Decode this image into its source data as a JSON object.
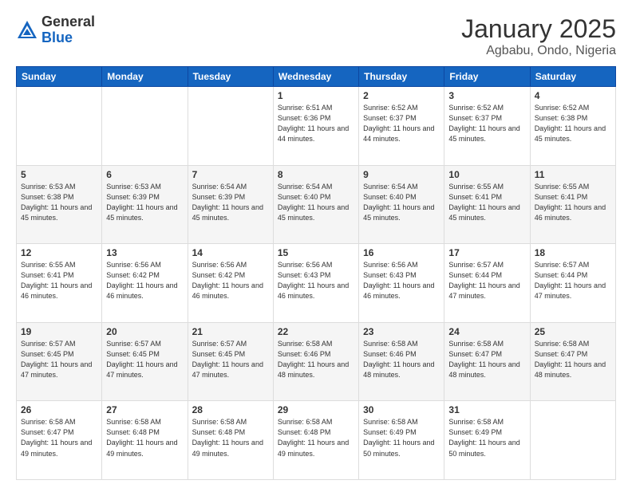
{
  "header": {
    "logo_general": "General",
    "logo_blue": "Blue",
    "month": "January 2025",
    "location": "Agbabu, Ondo, Nigeria"
  },
  "weekdays": [
    "Sunday",
    "Monday",
    "Tuesday",
    "Wednesday",
    "Thursday",
    "Friday",
    "Saturday"
  ],
  "weeks": [
    [
      {
        "day": "",
        "info": ""
      },
      {
        "day": "",
        "info": ""
      },
      {
        "day": "",
        "info": ""
      },
      {
        "day": "1",
        "info": "Sunrise: 6:51 AM\nSunset: 6:36 PM\nDaylight: 11 hours and 44 minutes."
      },
      {
        "day": "2",
        "info": "Sunrise: 6:52 AM\nSunset: 6:37 PM\nDaylight: 11 hours and 44 minutes."
      },
      {
        "day": "3",
        "info": "Sunrise: 6:52 AM\nSunset: 6:37 PM\nDaylight: 11 hours and 45 minutes."
      },
      {
        "day": "4",
        "info": "Sunrise: 6:52 AM\nSunset: 6:38 PM\nDaylight: 11 hours and 45 minutes."
      }
    ],
    [
      {
        "day": "5",
        "info": "Sunrise: 6:53 AM\nSunset: 6:38 PM\nDaylight: 11 hours and 45 minutes."
      },
      {
        "day": "6",
        "info": "Sunrise: 6:53 AM\nSunset: 6:39 PM\nDaylight: 11 hours and 45 minutes."
      },
      {
        "day": "7",
        "info": "Sunrise: 6:54 AM\nSunset: 6:39 PM\nDaylight: 11 hours and 45 minutes."
      },
      {
        "day": "8",
        "info": "Sunrise: 6:54 AM\nSunset: 6:40 PM\nDaylight: 11 hours and 45 minutes."
      },
      {
        "day": "9",
        "info": "Sunrise: 6:54 AM\nSunset: 6:40 PM\nDaylight: 11 hours and 45 minutes."
      },
      {
        "day": "10",
        "info": "Sunrise: 6:55 AM\nSunset: 6:41 PM\nDaylight: 11 hours and 45 minutes."
      },
      {
        "day": "11",
        "info": "Sunrise: 6:55 AM\nSunset: 6:41 PM\nDaylight: 11 hours and 46 minutes."
      }
    ],
    [
      {
        "day": "12",
        "info": "Sunrise: 6:55 AM\nSunset: 6:41 PM\nDaylight: 11 hours and 46 minutes."
      },
      {
        "day": "13",
        "info": "Sunrise: 6:56 AM\nSunset: 6:42 PM\nDaylight: 11 hours and 46 minutes."
      },
      {
        "day": "14",
        "info": "Sunrise: 6:56 AM\nSunset: 6:42 PM\nDaylight: 11 hours and 46 minutes."
      },
      {
        "day": "15",
        "info": "Sunrise: 6:56 AM\nSunset: 6:43 PM\nDaylight: 11 hours and 46 minutes."
      },
      {
        "day": "16",
        "info": "Sunrise: 6:56 AM\nSunset: 6:43 PM\nDaylight: 11 hours and 46 minutes."
      },
      {
        "day": "17",
        "info": "Sunrise: 6:57 AM\nSunset: 6:44 PM\nDaylight: 11 hours and 47 minutes."
      },
      {
        "day": "18",
        "info": "Sunrise: 6:57 AM\nSunset: 6:44 PM\nDaylight: 11 hours and 47 minutes."
      }
    ],
    [
      {
        "day": "19",
        "info": "Sunrise: 6:57 AM\nSunset: 6:45 PM\nDaylight: 11 hours and 47 minutes."
      },
      {
        "day": "20",
        "info": "Sunrise: 6:57 AM\nSunset: 6:45 PM\nDaylight: 11 hours and 47 minutes."
      },
      {
        "day": "21",
        "info": "Sunrise: 6:57 AM\nSunset: 6:45 PM\nDaylight: 11 hours and 47 minutes."
      },
      {
        "day": "22",
        "info": "Sunrise: 6:58 AM\nSunset: 6:46 PM\nDaylight: 11 hours and 48 minutes."
      },
      {
        "day": "23",
        "info": "Sunrise: 6:58 AM\nSunset: 6:46 PM\nDaylight: 11 hours and 48 minutes."
      },
      {
        "day": "24",
        "info": "Sunrise: 6:58 AM\nSunset: 6:47 PM\nDaylight: 11 hours and 48 minutes."
      },
      {
        "day": "25",
        "info": "Sunrise: 6:58 AM\nSunset: 6:47 PM\nDaylight: 11 hours and 48 minutes."
      }
    ],
    [
      {
        "day": "26",
        "info": "Sunrise: 6:58 AM\nSunset: 6:47 PM\nDaylight: 11 hours and 49 minutes."
      },
      {
        "day": "27",
        "info": "Sunrise: 6:58 AM\nSunset: 6:48 PM\nDaylight: 11 hours and 49 minutes."
      },
      {
        "day": "28",
        "info": "Sunrise: 6:58 AM\nSunset: 6:48 PM\nDaylight: 11 hours and 49 minutes."
      },
      {
        "day": "29",
        "info": "Sunrise: 6:58 AM\nSunset: 6:48 PM\nDaylight: 11 hours and 49 minutes."
      },
      {
        "day": "30",
        "info": "Sunrise: 6:58 AM\nSunset: 6:49 PM\nDaylight: 11 hours and 50 minutes."
      },
      {
        "day": "31",
        "info": "Sunrise: 6:58 AM\nSunset: 6:49 PM\nDaylight: 11 hours and 50 minutes."
      },
      {
        "day": "",
        "info": ""
      }
    ]
  ]
}
